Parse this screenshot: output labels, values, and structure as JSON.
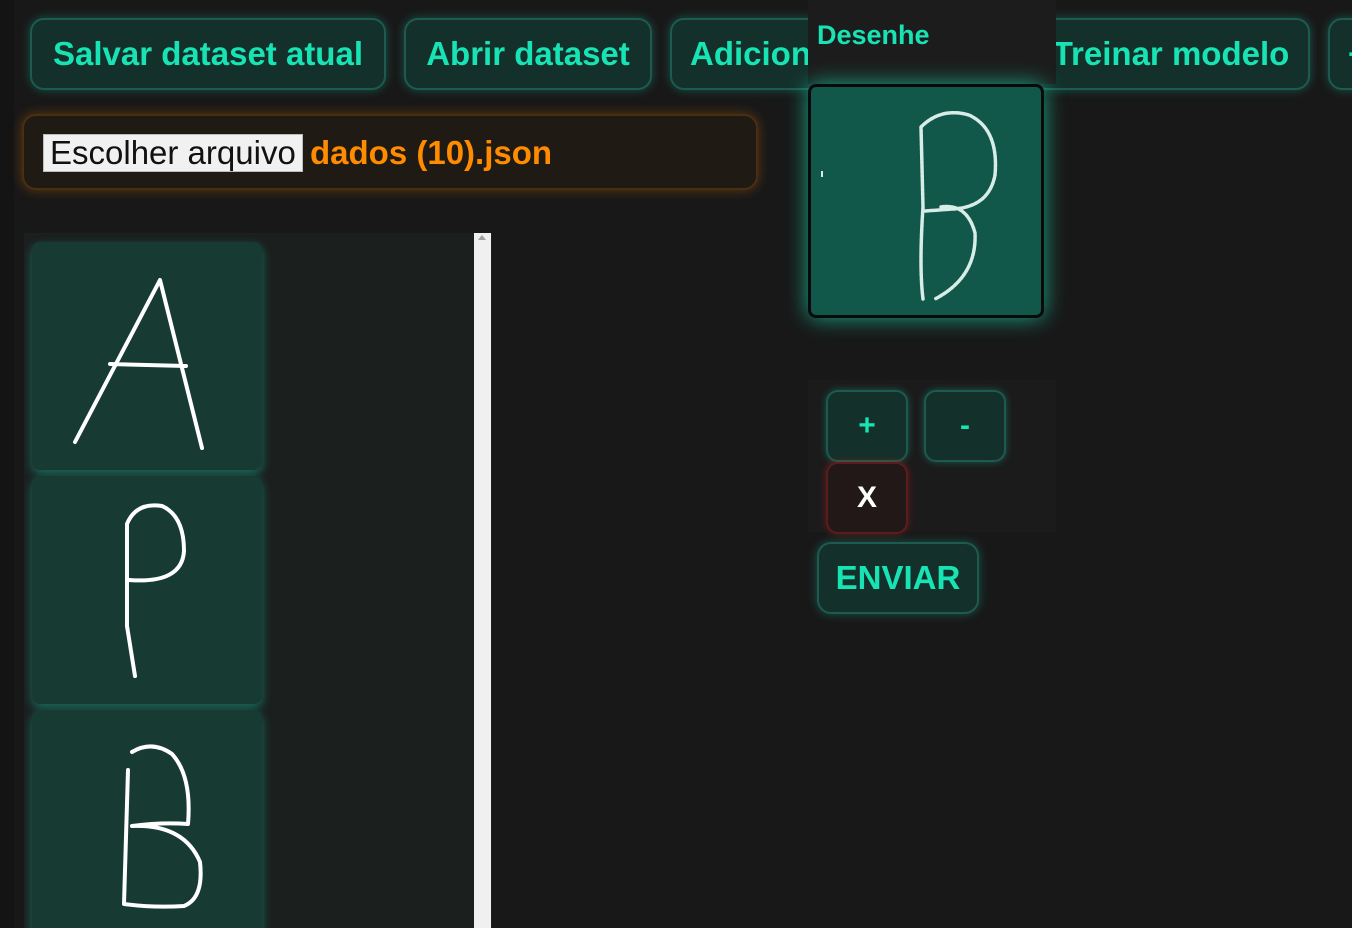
{
  "toolbar": {
    "save_label": "Salvar dataset atual",
    "open_label": "Abrir dataset",
    "add_label": "Adicionar desenho",
    "train_label": "Treinar modelo",
    "more_label": "+"
  },
  "file_input": {
    "button_label": "Escolher arquivo",
    "file_name": "dados (10).json"
  },
  "dataset_samples": [
    "A",
    "P",
    "B"
  ],
  "draw_panel": {
    "title": "Desenhe"
  },
  "controls": {
    "zoom_in": "+",
    "zoom_out": "-",
    "clear": "X",
    "send": "ENVIAR"
  },
  "colors": {
    "accent": "#18e3b4",
    "background": "#181818",
    "file_name": "#ff8c00",
    "canvas": "#11574a"
  }
}
